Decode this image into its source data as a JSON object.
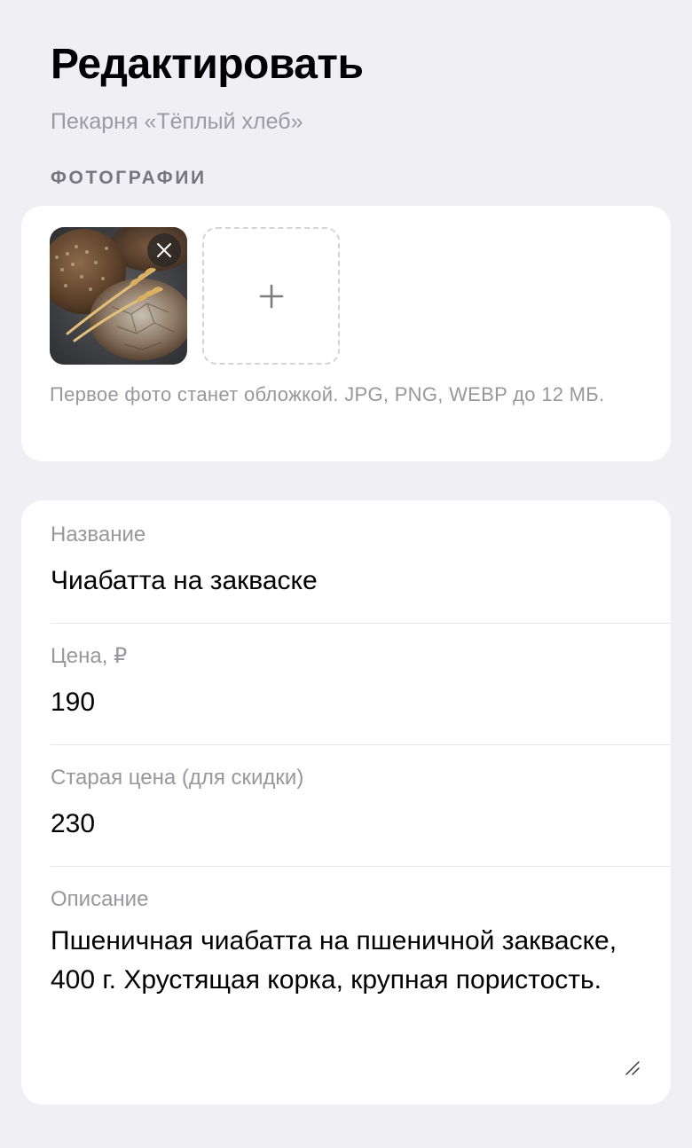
{
  "header": {
    "title": "Редактировать",
    "subtitle": "Пекарня «Тёплый хлеб»"
  },
  "photos": {
    "section_label": "ФОТОГРАФИИ",
    "items": [
      {
        "icon": "bread-photo",
        "remove_icon": "close-icon"
      }
    ],
    "add_icon": "plus-icon",
    "hint": "Первое фото станет обложкой. JPG, PNG, WEBP до 12 МБ."
  },
  "form": {
    "name": {
      "label": "Название",
      "value": "Чиабатта на закваске"
    },
    "price": {
      "label": "Цена, ₽",
      "value": "190"
    },
    "old_price": {
      "label": "Старая цена (для скидки)",
      "value": "230"
    },
    "description": {
      "label": "Описание",
      "value": "Пшеничная чиабатта на пшеничной закваске, 400 г. Хрустящая корка, крупная пористость.",
      "resize_icon": "resize-handle-icon"
    }
  }
}
